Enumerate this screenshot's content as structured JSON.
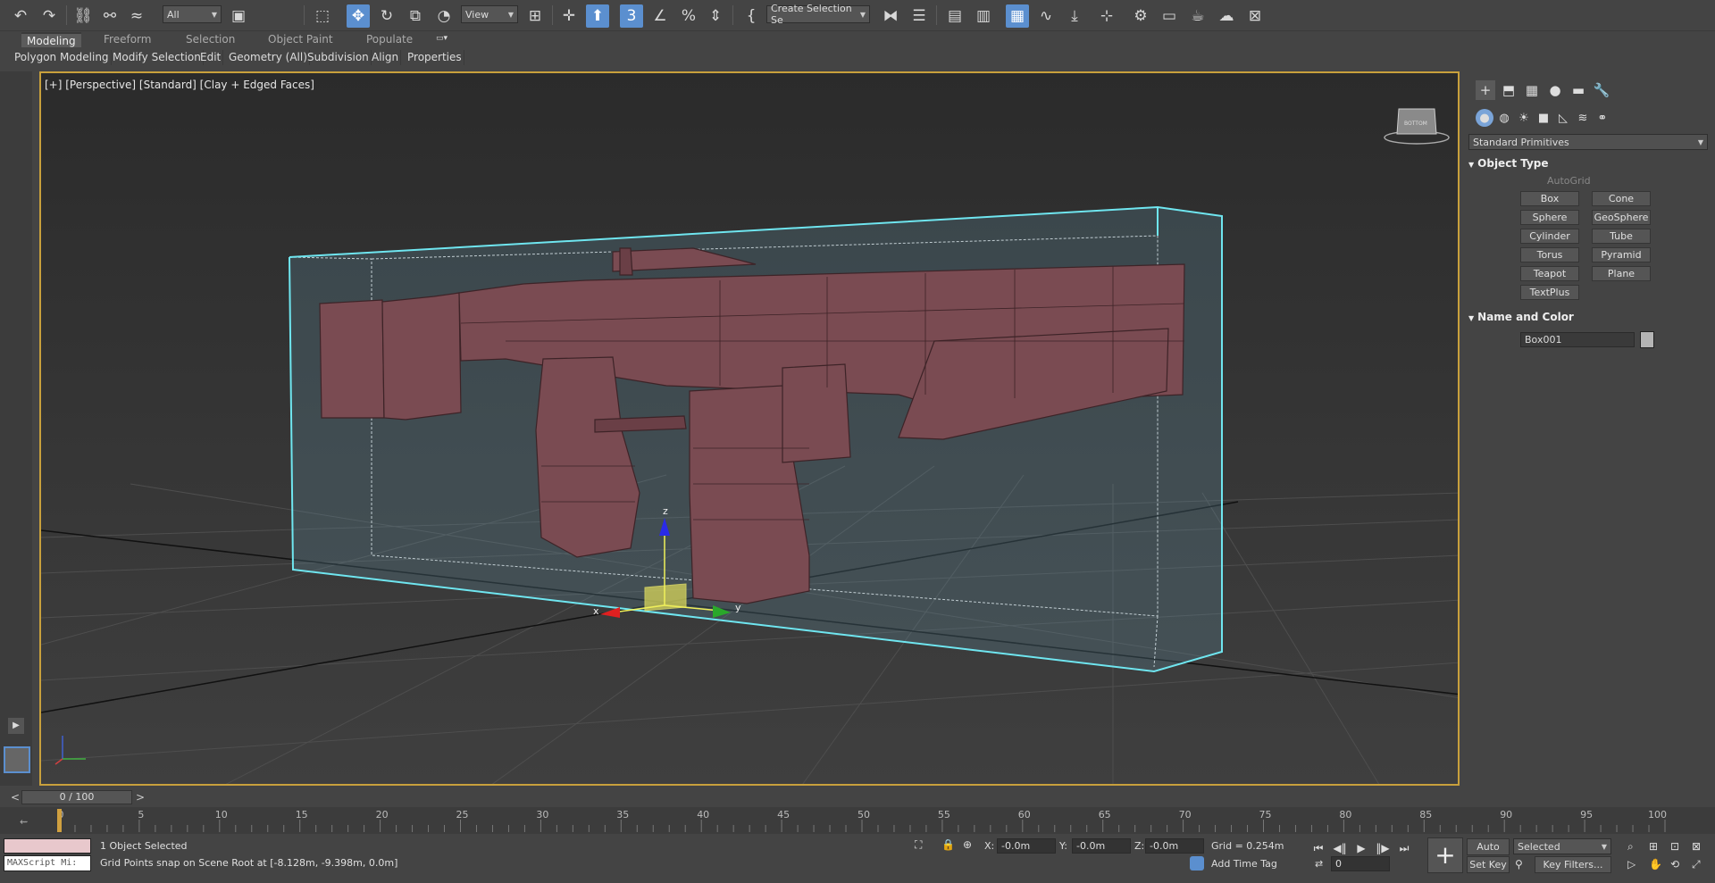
{
  "toolbar": {
    "filter_value": "All",
    "refcoord_value": "View",
    "named_selection_placeholder": "Create Selection Se"
  },
  "ribbon": {
    "tabs": [
      "Modeling",
      "Freeform",
      "Selection",
      "Object Paint",
      "Populate"
    ],
    "sub_items": [
      "Polygon Modeling",
      "Modify Selection",
      "Edit",
      "Geometry (All)",
      "Subdivision",
      "Align",
      "Properties"
    ]
  },
  "viewport": {
    "label": "[+] [Perspective] [Standard] [Clay + Edged Faces]",
    "gizmo_axes": {
      "x": "x",
      "y": "y",
      "z": "z"
    },
    "viewcube_text": "BOTTOM"
  },
  "command_panel": {
    "category_dropdown": "Standard Primitives",
    "object_type_header": "Object Type",
    "autogrid_label": "AutoGrid",
    "primitives": [
      "Box",
      "Cone",
      "Sphere",
      "GeoSphere",
      "Cylinder",
      "Tube",
      "Torus",
      "Pyramid",
      "Teapot",
      "Plane",
      "TextPlus"
    ],
    "name_color_header": "Name and Color",
    "object_name": "Box001"
  },
  "time_slider": {
    "frame_label": "0 / 100",
    "prev": "<",
    "next": ">"
  },
  "trackbar": {
    "ticks": [
      "0",
      "5",
      "10",
      "15",
      "20",
      "25",
      "30",
      "35",
      "40",
      "45",
      "50",
      "55",
      "60",
      "65",
      "70",
      "75",
      "80",
      "85",
      "90",
      "95",
      "100"
    ]
  },
  "status": {
    "selection_text": "1 Object Selected",
    "prompt_text": "Grid Points snap on Scene Root at [-8.128m, -9.398m, 0.0m]",
    "maxscript_placeholder": "MAXScript Mi:",
    "x_label": "X:",
    "x_value": "-0.0m",
    "y_label": "Y:",
    "y_value": "-0.0m",
    "z_label": "Z:",
    "z_value": "-0.0m",
    "grid_text": "Grid = 0.254m",
    "add_time_tag": "Add Time Tag",
    "auto_key": "Auto Key",
    "set_key": "Set Key",
    "key_mode_value": "Selected",
    "key_filters": "Key Filters...",
    "frame_value": "0"
  },
  "colors": {
    "accent_blue": "#5b8fcf",
    "viewport_border": "#c8a03c",
    "selection_box": "#6fe6f0",
    "model_fill": "#7a4b52"
  }
}
